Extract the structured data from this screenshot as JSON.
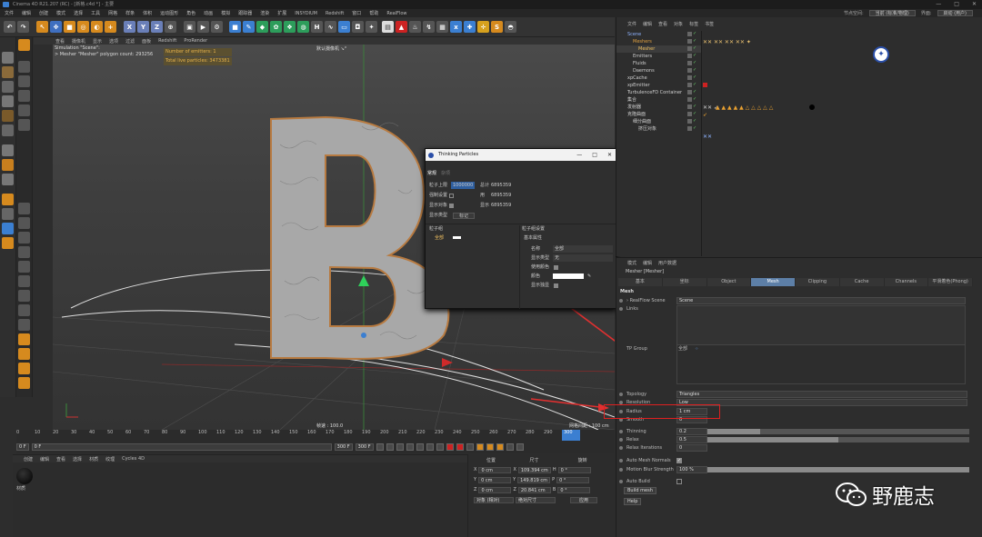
{
  "window": {
    "title": "Cinema 4D R21.207 (RC) - [新格.c4d *] - 主要",
    "controls": [
      "—",
      "□",
      "✕"
    ]
  },
  "menubar": {
    "items": [
      "文件",
      "编辑",
      "创建",
      "模式",
      "选择",
      "工具",
      "网格",
      "样条",
      "体积",
      "运动图形",
      "角色",
      "动画",
      "模拟",
      "跟踪器",
      "渲染",
      "扩展",
      "INSYDIUM",
      "Redshift",
      "窗口",
      "帮助",
      "RealFlow"
    ],
    "node_space_label": "节点空间:",
    "node_space_value": "当前 (标准/物理)",
    "interface_label": "界面:",
    "interface_value": "启动 (用户)"
  },
  "toolbar": {
    "axis_buttons": [
      "X",
      "Y",
      "Z"
    ]
  },
  "viewport": {
    "menu": [
      "查看",
      "摄像机",
      "显示",
      "选项",
      "过滤",
      "面板",
      "Redshift",
      "ProRender"
    ],
    "camera_label": "默认摄像机 ↘°",
    "info_line1": "Simulation \"Scene\":",
    "info_line2": "> Mesher \"Mesher\" polygon count: 293256",
    "emitters_msg": "Number of emitters: 1",
    "particles_msg": "Total live particles: 3473381",
    "speed_label": "帧速 : 100.0",
    "grid_label": "网格间距 : 100 cm",
    "letter": "B"
  },
  "timeline": {
    "ticks": [
      "0",
      "10",
      "20",
      "30",
      "40",
      "50",
      "60",
      "70",
      "80",
      "90",
      "100",
      "110",
      "120",
      "130",
      "140",
      "150",
      "160",
      "170",
      "180",
      "190",
      "200",
      "210",
      "220",
      "230",
      "240",
      "250",
      "260",
      "270",
      "280",
      "290",
      "300"
    ],
    "start_frame": "0 F",
    "current_frame": "0 F",
    "end_frame": "300 F",
    "end_frame2": "300 F",
    "playhead_frame": "300 F"
  },
  "materials": {
    "menu": [
      "创建",
      "编辑",
      "查看",
      "选择",
      "材质",
      "纹理",
      "Cycles 4D"
    ],
    "material_name": "材质"
  },
  "coordinates": {
    "headers": [
      "位置",
      "尺寸",
      "旋转"
    ],
    "rows": [
      {
        "axis": "X",
        "pos": "0 cm",
        "size": "109.394 cm",
        "rot_axis": "H",
        "rot": "0 °"
      },
      {
        "axis": "Y",
        "pos": "0 cm",
        "size": "149.819 cm",
        "rot_axis": "P",
        "rot": "0 °"
      },
      {
        "axis": "Z",
        "pos": "0 cm",
        "size": "20.841 cm",
        "rot_axis": "B",
        "rot": "0 °"
      }
    ],
    "mode_dropdown": "对象 (相对)",
    "size_dropdown": "绝对尺寸",
    "apply_button": "应用"
  },
  "object_manager": {
    "menu": [
      "文件",
      "编辑",
      "查看",
      "对象",
      "标签",
      "书签"
    ],
    "objects": [
      {
        "name": "Scene",
        "color": "#8fb4ff",
        "indent": 0
      },
      {
        "name": "Meshers",
        "color": "#e0a040",
        "indent": 1
      },
      {
        "name": "Mesher",
        "color": "#f0c060",
        "indent": 2
      },
      {
        "name": "Emitters",
        "color": "#cfcfcf",
        "indent": 1
      },
      {
        "name": "Fluids",
        "color": "#cfcfcf",
        "indent": 1
      },
      {
        "name": "Daemons",
        "color": "#cfcfcf",
        "indent": 1
      },
      {
        "name": "xpCache",
        "color": "#cfcfcf",
        "indent": 0
      },
      {
        "name": "xpEmitter",
        "color": "#cfcfcf",
        "indent": 0
      },
      {
        "name": "TurbulenceFD Container",
        "color": "#cfcfcf",
        "indent": 0
      },
      {
        "name": "集合",
        "color": "#cfcfcf",
        "indent": 0
      },
      {
        "name": "发射器",
        "color": "#cfcfcf",
        "indent": 0
      },
      {
        "name": "克隆曲面",
        "color": "#cfcfcf",
        "indent": 0
      },
      {
        "name": "细分曲面",
        "color": "#cfcfcf",
        "indent": 1
      },
      {
        "name": "挤压对象",
        "color": "#cfcfcf",
        "indent": 2
      }
    ]
  },
  "attribute_manager": {
    "menu": [
      "模式",
      "编辑",
      "用户数据"
    ],
    "object_title": "Mesher [Mesher]",
    "tabs": [
      "基本",
      "坐标",
      "Object",
      "Mesh",
      "Clipping",
      "Cache",
      "Channels",
      "平滑着色(Phong)"
    ],
    "active_tab": "Mesh",
    "section": "Mesh",
    "realflow_scene_label": "› RealFlow Scene",
    "realflow_scene_value": "Scene",
    "links_label": "Links",
    "tp_group_label": "TP Group",
    "tp_group_value": "全部",
    "topology_label": "Topology",
    "topology_value": "Triangles",
    "resolution_label": "Resolution",
    "resolution_value": "Low",
    "radius_label": "Radius",
    "radius_value": "1 cm",
    "smooth_label": "Smooth",
    "smooth_value": "0",
    "thinning_label": "Thinning",
    "thinning_value": "0.2",
    "relax_label": "Relax",
    "relax_value": "0.5",
    "relax_iter_label": "Relax Iterations",
    "relax_iter_value": "0",
    "auto_normals_label": "Auto Mesh Normals",
    "motion_blur_label": "Motion Blur Strength",
    "motion_blur_value": "100 %",
    "auto_build_label": "Auto Build",
    "build_mesh_button": "Build mesh",
    "help_button": "Help",
    "slider_levels": {
      "thinning": 0.2,
      "relax": 0.5,
      "motion_blur": 1.0
    }
  },
  "tp_window": {
    "title": "Thinking Particles",
    "tabs": [
      "常规",
      "杂项"
    ],
    "max_particles_label": "粒子上限",
    "max_particles_value": "1000000",
    "total_label": "总计",
    "total_value": "6895359",
    "force_label": "强制设置",
    "show_label": "显示对象",
    "used_label": "用",
    "used_value": "6895359",
    "show_type_label": "显示类型",
    "show_type_value": "标记",
    "display_label": "显示",
    "display_value": "6895359",
    "group_header": "粒子组",
    "group_item": "全部",
    "group_settings_header": "粒子组设置",
    "basic_props": "基本属性",
    "name_label": "名称",
    "name_value": "全部",
    "show_type2_label": "显示类型",
    "show_type2_value": "无",
    "use_color_label": "使用颜色",
    "color_label": "颜色",
    "show_only_label": "显示独显"
  },
  "watermark": {
    "text": "野鹿志"
  }
}
